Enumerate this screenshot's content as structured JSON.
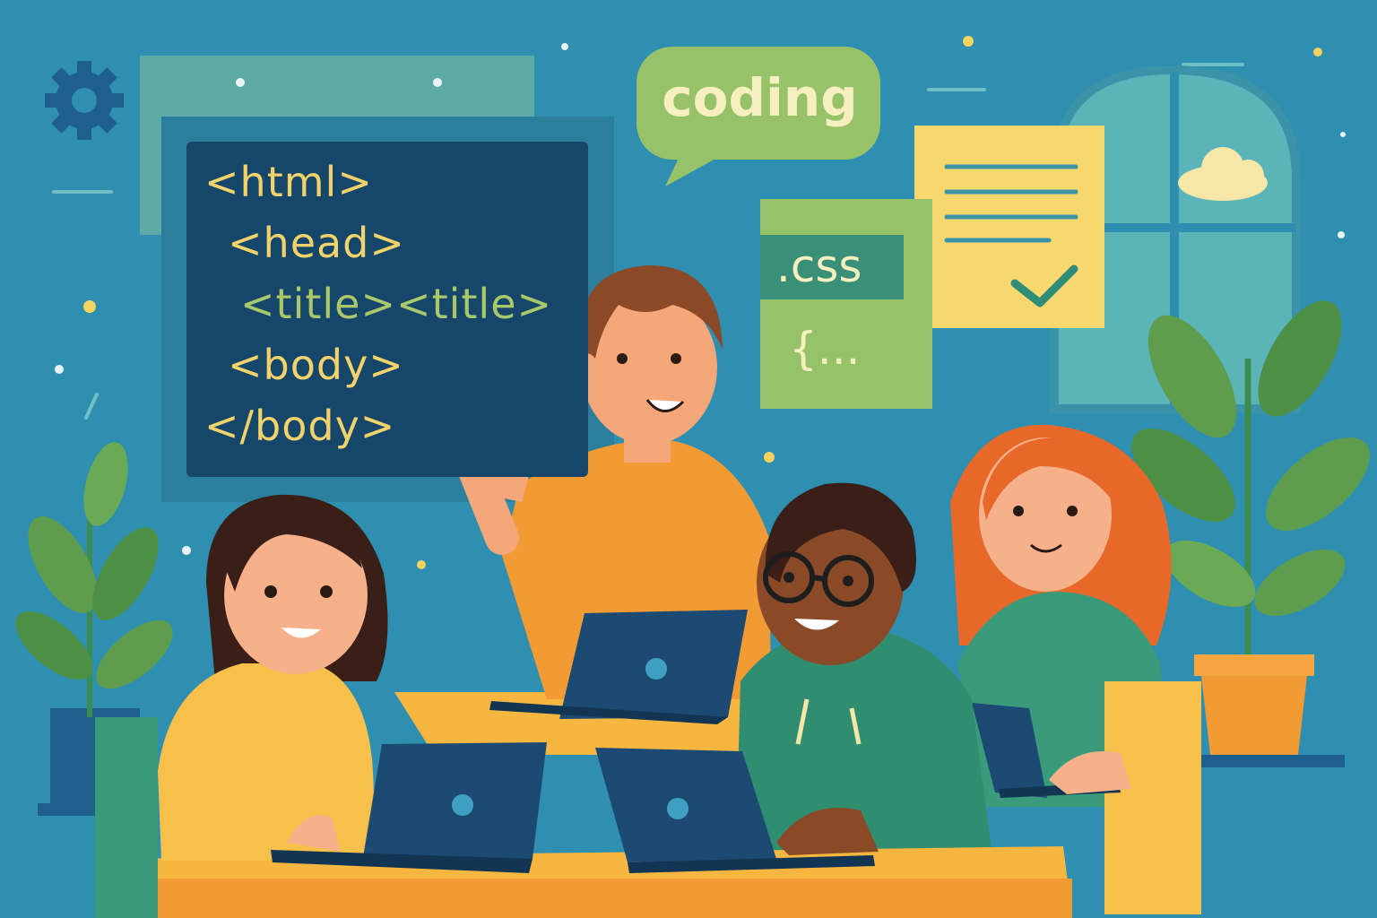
{
  "code_board": {
    "lines": [
      {
        "text": "<html>"
      },
      {
        "text": "<head>"
      },
      {
        "text": "<title><title>"
      },
      {
        "text": "<body>"
      },
      {
        "text": "</body>"
      }
    ]
  },
  "speech_bubble": {
    "text": "coding"
  },
  "css_card": {
    "label": ".css",
    "brace": "{..."
  },
  "colors": {
    "background": "#2f8fb0",
    "board": "#17466b",
    "code_text": "#f2d36b",
    "bubble": "#98c26a",
    "doc_card": "#f6d86f",
    "accent_teal": "#3a8f79",
    "accent_orange": "#f29a33"
  },
  "icons": [
    "gear-icon",
    "check-icon",
    "cloud-icon",
    "window-icon",
    "plant-icon",
    "laptop-icon"
  ]
}
